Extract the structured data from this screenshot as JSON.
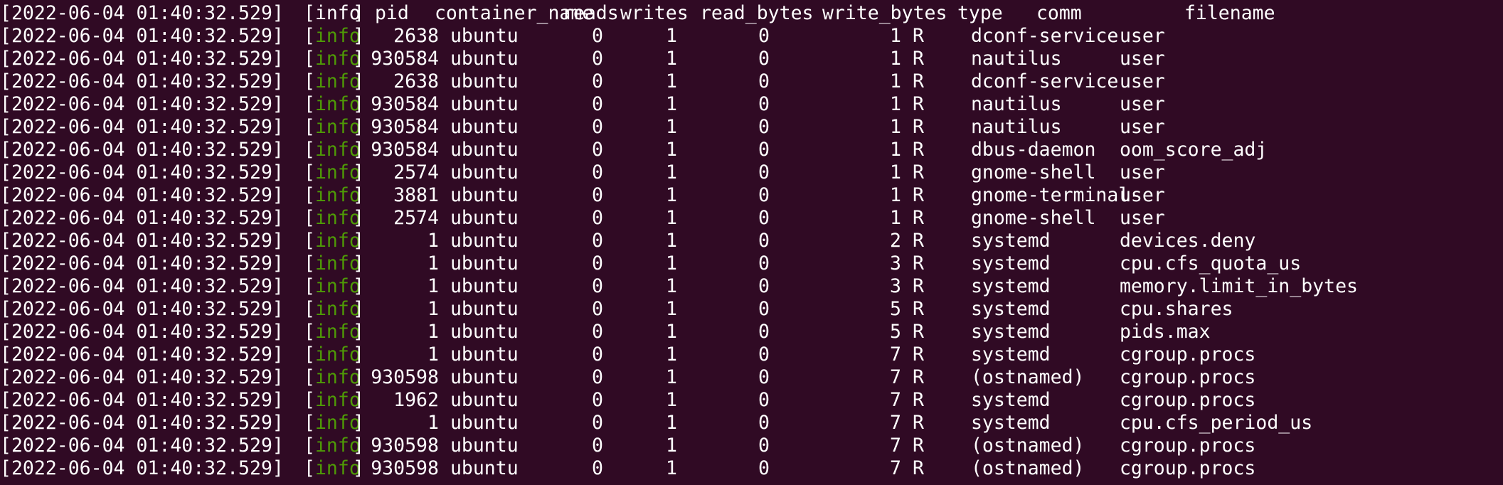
{
  "header": {
    "timestamp": "[2022-06-04 01:40:32.529]",
    "level": "info",
    "cols": [
      "pid",
      "container_name",
      "reads",
      "writes",
      "read_bytes",
      "write_bytes",
      "type",
      "comm",
      "filename"
    ]
  },
  "rows": [
    {
      "ts": "[2022-06-04 01:40:32.529]",
      "level": "info",
      "pid": "2638",
      "container": "ubuntu",
      "reads": "0",
      "writes": "1",
      "read_bytes": "0",
      "write_bytes": "1",
      "type": "R",
      "comm": "dconf-service",
      "filename": "user"
    },
    {
      "ts": "[2022-06-04 01:40:32.529]",
      "level": "info",
      "pid": "930584",
      "container": "ubuntu",
      "reads": "0",
      "writes": "1",
      "read_bytes": "0",
      "write_bytes": "1",
      "type": "R",
      "comm": "nautilus",
      "filename": "user"
    },
    {
      "ts": "[2022-06-04 01:40:32.529]",
      "level": "info",
      "pid": "2638",
      "container": "ubuntu",
      "reads": "0",
      "writes": "1",
      "read_bytes": "0",
      "write_bytes": "1",
      "type": "R",
      "comm": "dconf-service",
      "filename": "user"
    },
    {
      "ts": "[2022-06-04 01:40:32.529]",
      "level": "info",
      "pid": "930584",
      "container": "ubuntu",
      "reads": "0",
      "writes": "1",
      "read_bytes": "0",
      "write_bytes": "1",
      "type": "R",
      "comm": "nautilus",
      "filename": "user"
    },
    {
      "ts": "[2022-06-04 01:40:32.529]",
      "level": "info",
      "pid": "930584",
      "container": "ubuntu",
      "reads": "0",
      "writes": "1",
      "read_bytes": "0",
      "write_bytes": "1",
      "type": "R",
      "comm": "nautilus",
      "filename": "user"
    },
    {
      "ts": "[2022-06-04 01:40:32.529]",
      "level": "info",
      "pid": "930584",
      "container": "ubuntu",
      "reads": "0",
      "writes": "1",
      "read_bytes": "0",
      "write_bytes": "1",
      "type": "R",
      "comm": "dbus-daemon",
      "filename": "oom_score_adj"
    },
    {
      "ts": "[2022-06-04 01:40:32.529]",
      "level": "info",
      "pid": "2574",
      "container": "ubuntu",
      "reads": "0",
      "writes": "1",
      "read_bytes": "0",
      "write_bytes": "1",
      "type": "R",
      "comm": "gnome-shell",
      "filename": "user"
    },
    {
      "ts": "[2022-06-04 01:40:32.529]",
      "level": "info",
      "pid": "3881",
      "container": "ubuntu",
      "reads": "0",
      "writes": "1",
      "read_bytes": "0",
      "write_bytes": "1",
      "type": "R",
      "comm": "gnome-terminal-",
      "filename": "user"
    },
    {
      "ts": "[2022-06-04 01:40:32.529]",
      "level": "info",
      "pid": "2574",
      "container": "ubuntu",
      "reads": "0",
      "writes": "1",
      "read_bytes": "0",
      "write_bytes": "1",
      "type": "R",
      "comm": "gnome-shell",
      "filename": "user"
    },
    {
      "ts": "[2022-06-04 01:40:32.529]",
      "level": "info",
      "pid": "1",
      "container": "ubuntu",
      "reads": "0",
      "writes": "1",
      "read_bytes": "0",
      "write_bytes": "2",
      "type": "R",
      "comm": "systemd",
      "filename": "devices.deny"
    },
    {
      "ts": "[2022-06-04 01:40:32.529]",
      "level": "info",
      "pid": "1",
      "container": "ubuntu",
      "reads": "0",
      "writes": "1",
      "read_bytes": "0",
      "write_bytes": "3",
      "type": "R",
      "comm": "systemd",
      "filename": "cpu.cfs_quota_us"
    },
    {
      "ts": "[2022-06-04 01:40:32.529]",
      "level": "info",
      "pid": "1",
      "container": "ubuntu",
      "reads": "0",
      "writes": "1",
      "read_bytes": "0",
      "write_bytes": "3",
      "type": "R",
      "comm": "systemd",
      "filename": "memory.limit_in_bytes"
    },
    {
      "ts": "[2022-06-04 01:40:32.529]",
      "level": "info",
      "pid": "1",
      "container": "ubuntu",
      "reads": "0",
      "writes": "1",
      "read_bytes": "0",
      "write_bytes": "5",
      "type": "R",
      "comm": "systemd",
      "filename": "cpu.shares"
    },
    {
      "ts": "[2022-06-04 01:40:32.529]",
      "level": "info",
      "pid": "1",
      "container": "ubuntu",
      "reads": "0",
      "writes": "1",
      "read_bytes": "0",
      "write_bytes": "5",
      "type": "R",
      "comm": "systemd",
      "filename": "pids.max"
    },
    {
      "ts": "[2022-06-04 01:40:32.529]",
      "level": "info",
      "pid": "1",
      "container": "ubuntu",
      "reads": "0",
      "writes": "1",
      "read_bytes": "0",
      "write_bytes": "7",
      "type": "R",
      "comm": "systemd",
      "filename": "cgroup.procs"
    },
    {
      "ts": "[2022-06-04 01:40:32.529]",
      "level": "info",
      "pid": "930598",
      "container": "ubuntu",
      "reads": "0",
      "writes": "1",
      "read_bytes": "0",
      "write_bytes": "7",
      "type": "R",
      "comm": "(ostnamed)",
      "filename": "cgroup.procs"
    },
    {
      "ts": "[2022-06-04 01:40:32.529]",
      "level": "info",
      "pid": "1962",
      "container": "ubuntu",
      "reads": "0",
      "writes": "1",
      "read_bytes": "0",
      "write_bytes": "7",
      "type": "R",
      "comm": "systemd",
      "filename": "cgroup.procs"
    },
    {
      "ts": "[2022-06-04 01:40:32.529]",
      "level": "info",
      "pid": "1",
      "container": "ubuntu",
      "reads": "0",
      "writes": "1",
      "read_bytes": "0",
      "write_bytes": "7",
      "type": "R",
      "comm": "systemd",
      "filename": "cpu.cfs_period_us"
    },
    {
      "ts": "[2022-06-04 01:40:32.529]",
      "level": "info",
      "pid": "930598",
      "container": "ubuntu",
      "reads": "0",
      "writes": "1",
      "read_bytes": "0",
      "write_bytes": "7",
      "type": "R",
      "comm": "(ostnamed)",
      "filename": "cgroup.procs"
    },
    {
      "ts": "[2022-06-04 01:40:32.529]",
      "level": "info",
      "pid": "930598",
      "container": "ubuntu",
      "reads": "0",
      "writes": "1",
      "read_bytes": "0",
      "write_bytes": "7",
      "type": "R",
      "comm": "(ostnamed)",
      "filename": "cgroup.procs"
    }
  ],
  "colors": {
    "background": "#300a24",
    "text": "#ffffff",
    "info": "#4e9a06"
  }
}
